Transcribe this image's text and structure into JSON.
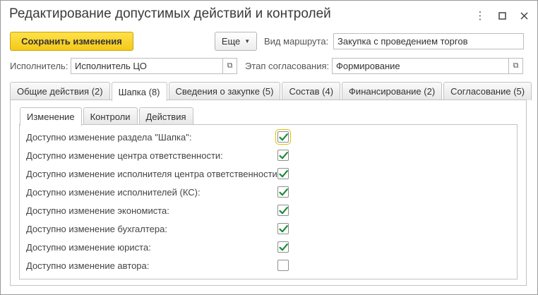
{
  "window": {
    "title": "Редактирование допустимых действий и контролей",
    "controls": [
      "more-vert-icon",
      "maximize-icon",
      "close-icon"
    ]
  },
  "toolbar": {
    "save_label": "Сохранить изменения",
    "more_label": "Еще",
    "route_label": "Вид маршрута:",
    "route_value": "Закупка с проведением торгов"
  },
  "fields": {
    "executor_label": "Исполнитель:",
    "executor_value": "Исполнитель ЦО",
    "stage_label": "Этап согласования:",
    "stage_value": "Формирование"
  },
  "tabs": [
    {
      "label": "Общие действия (2)",
      "active": false
    },
    {
      "label": "Шапка (8)",
      "active": true
    },
    {
      "label": "Сведения о закупке (5)",
      "active": false
    },
    {
      "label": "Состав (4)",
      "active": false
    },
    {
      "label": "Финансирование (2)",
      "active": false
    },
    {
      "label": "Согласование (5)",
      "active": false
    }
  ],
  "subtabs": [
    {
      "label": "Изменение",
      "active": true
    },
    {
      "label": "Контроли",
      "active": false
    },
    {
      "label": "Действия",
      "active": false
    }
  ],
  "permissions": [
    {
      "label": "Доступно изменение раздела \"Шапка\":",
      "checked": true
    },
    {
      "label": "Доступно изменение центра ответственности:",
      "checked": true
    },
    {
      "label": "Доступно изменение исполнителя центра ответственности:",
      "checked": true
    },
    {
      "label": "Доступно изменение исполнителей (КС):",
      "checked": true
    },
    {
      "label": "Доступно изменение экономиста:",
      "checked": true
    },
    {
      "label": "Доступно изменение бухгалтера:",
      "checked": true
    },
    {
      "label": "Доступно изменение юриста:",
      "checked": true
    },
    {
      "label": "Доступно изменение автора:",
      "checked": false
    }
  ],
  "colors": {
    "accent_yellow": "#f4c91a",
    "check_green": "#1e8a3a"
  }
}
